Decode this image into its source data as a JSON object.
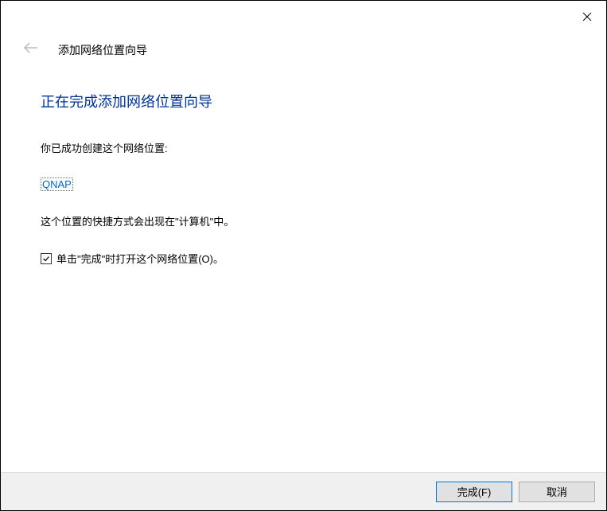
{
  "header": {
    "wizard_title": "添加网络位置向导"
  },
  "content": {
    "heading": "正在完成添加网络位置向导",
    "success_text": "你已成功创建这个网络位置:",
    "location_name": "QNAP",
    "shortcut_text": "这个位置的快捷方式会出现在\"计算机\"中。",
    "checkbox_label": "单击\"完成\"时打开这个网络位置(O)。"
  },
  "footer": {
    "finish_label": "完成(F)",
    "cancel_label": "取消"
  }
}
